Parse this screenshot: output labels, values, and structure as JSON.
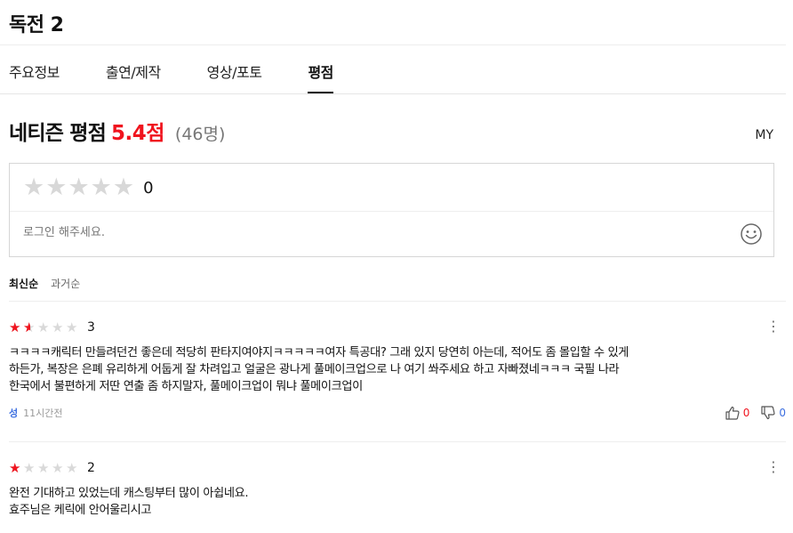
{
  "page": {
    "title": "독전 2"
  },
  "tabs": [
    {
      "label": "주요정보",
      "active": false
    },
    {
      "label": "출연/제작",
      "active": false
    },
    {
      "label": "영상/포토",
      "active": false
    },
    {
      "label": "평점",
      "active": true
    }
  ],
  "rating": {
    "title": "네티즌 평점",
    "score": "5.4점",
    "count": "(46명)",
    "my_label": "MY"
  },
  "input": {
    "star_value": "0",
    "placeholder": "로그인 해주세요.",
    "emoji_icon": "smiley-icon"
  },
  "sort": {
    "latest": "최신순",
    "oldest": "과거순",
    "active": "latest"
  },
  "reviews": [
    {
      "rating": 1.5,
      "score": "3",
      "text": "ㅋㅋㅋㅋ캐릭터 만들려던건 좋은데 적당히 판타지여야지ㅋㅋㅋㅋㅋ여자 특공대? 그래 있지 당연히 아는데, 적어도 좀 몰입할 수 있게\n하든가, 복장은 은폐 유리하게 어둡게 잘 차려입고 얼굴은 광나게 풀메이크업으로 나 여기 쏴주세요 하고 자빠졌네ㅋㅋㅋ 국필 나라\n한국에서 불편하게 저딴 연출 좀 하지말자, 풀메이크업이 뭐냐 풀메이크업이",
      "author": "성",
      "time": "11시간전",
      "likes": "0",
      "dislikes": "0"
    },
    {
      "rating": 1,
      "score": "2",
      "text": "완전 기대하고 있었는데 캐스팅부터 많이 아쉽네요.\n효주님은 케릭에 안어울리시고",
      "author": "",
      "time": "",
      "likes": "",
      "dislikes": ""
    }
  ],
  "colors": {
    "accent_red": "#f0141e",
    "accent_blue": "#3d6fe0",
    "star_empty": "#d9d9d9"
  }
}
